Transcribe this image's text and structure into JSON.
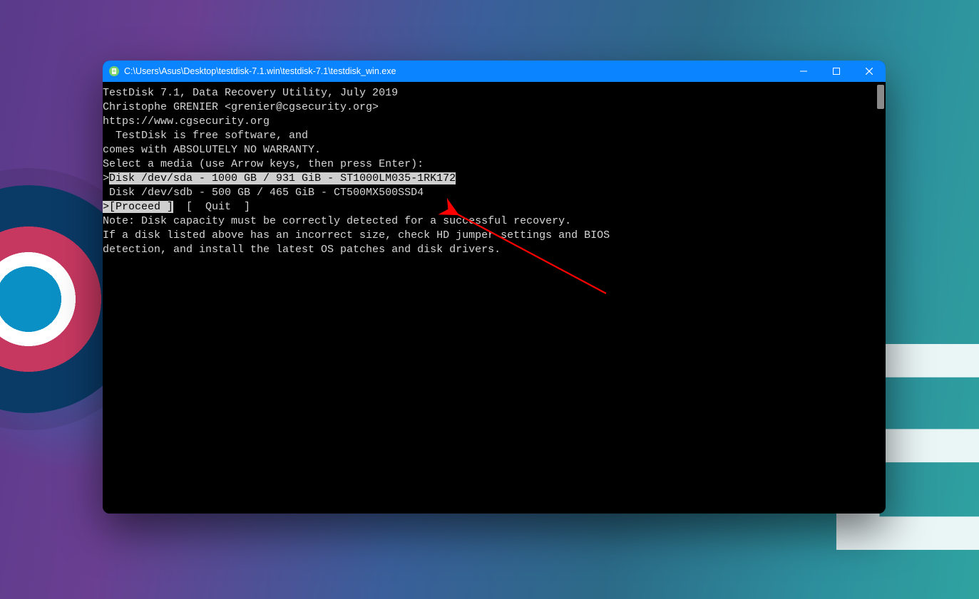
{
  "window": {
    "title": "C:\\Users\\Asus\\Desktop\\testdisk-7.1.win\\testdisk-7.1\\testdisk_win.exe"
  },
  "term": {
    "l1": "TestDisk 7.1, Data Recovery Utility, July 2019",
    "l2": "Christophe GRENIER <grenier@cgsecurity.org>",
    "l3": "https://www.cgsecurity.org",
    "blank": "",
    "free1": "  TestDisk is free software, and",
    "free2": "comes with ABSOLUTELY NO WARRANTY.",
    "select": "Select a media (use Arrow keys, then press Enter):",
    "disk_sel_prefix": ">",
    "disk_sel": "Disk /dev/sda - 1000 GB / 931 GiB - ST1000LM035-1RK172",
    "disk2": " Disk /dev/sdb - 500 GB / 465 GiB - CT500MX500SSD4",
    "menu_prefix": ">",
    "menu_proceed": "[Proceed ]",
    "menu_gap": "  ",
    "menu_quit": "[  Quit  ]",
    "note1": "Note: Disk capacity must be correctly detected for a successful recovery.",
    "note2": "If a disk listed above has an incorrect size, check HD jumper settings and BIOS",
    "note3": "detection, and install the latest OS patches and disk drivers."
  }
}
